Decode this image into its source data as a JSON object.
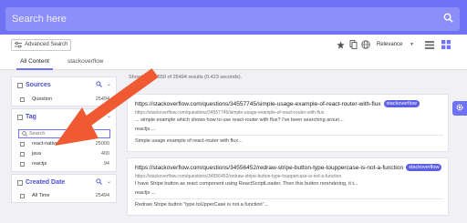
{
  "search": {
    "placeholder": "Search here",
    "value": ""
  },
  "toolbar": {
    "advanced_search_label": "Advanced Search",
    "sort": {
      "selected": "Relevance"
    }
  },
  "tabs": [
    {
      "label": "All Content",
      "active": true
    },
    {
      "label": "stackoverflow",
      "active": false
    }
  ],
  "sidebar": {
    "sources": {
      "title": "Sources",
      "items": [
        {
          "label": "Question",
          "count": "25494"
        }
      ]
    },
    "tag": {
      "title": "Tag",
      "search_placeholder": "Search",
      "items": [
        {
          "label": "react-native",
          "count": "25000"
        },
        {
          "label": "java",
          "count": "400"
        },
        {
          "label": "reactjs",
          "count": "94"
        }
      ]
    },
    "created_date": {
      "title": "Created Date",
      "items": [
        {
          "label": "All Time",
          "count": "25494"
        }
      ]
    }
  },
  "results_summary": "Showing 1 - 10 of 25494 results (0.423 seconds).",
  "results_summary_visible": "Showing ... 3550 of 25494 results (0.423 seconds).",
  "results": [
    {
      "url": "https://stackoverflow.com/questions/34557745/simple-usage-example-of-react-router-with-flux",
      "badge": "stackoverflow",
      "sub_url": "https://stackoverflow.com/questions/34557745/simple-usage-example-of-react-router-with-flux",
      "snippet": "... simple example which shows how to use react-router with flux? I've been searching aroun...",
      "tag_line": "reactjs ...",
      "title_line": "Simple usage example of react-router with flux..."
    },
    {
      "url": "https://stackoverflow.com/questions/34556452/redraw-stripe-button-type-touppercase-is-not-a-function",
      "badge": "stackoverflow",
      "sub_url": "https://stackoverflow.com/questions/34556452/redraw-stripe-button-type-touppercase-is-not-a-function",
      "snippet": "I have Stripe button as react component using ReactScriptLoader. Then this button rerendering, it t...",
      "tag_line": "reactjs ...",
      "title_line": "Redraw Stripe button \"type.toUpperCase is not a function\"..."
    }
  ],
  "colors": {
    "accent": "#6f72f5",
    "badge": "#5b5fe3",
    "arrow": "#ef5a32",
    "facet_title": "#4a4fd0"
  }
}
